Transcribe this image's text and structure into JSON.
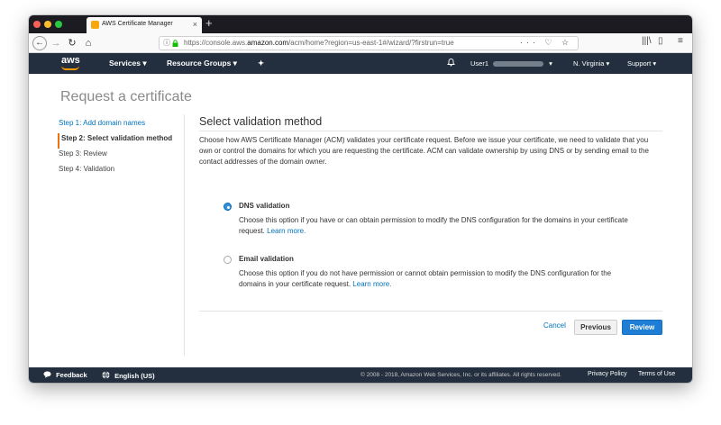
{
  "browser": {
    "tab_title": "AWS Certificate Manager",
    "tab_close": "×",
    "new_tab": "+",
    "url_prefix": "https://console.aws.",
    "url_domain": "amazon.com",
    "url_path": "/acm/home?region=us-east-1#/wizard/?firstrun=true",
    "nav": {
      "back": "←",
      "forward": "→",
      "reload": "↻",
      "home": "⌂",
      "info": "ⓘ",
      "actions": "··· ♡ ☆",
      "library": "|||\\",
      "sidebar": "▯",
      "menu": "≡"
    }
  },
  "aws_header": {
    "logo": "aws",
    "services": "Services ▾",
    "resource_groups": "Resource Groups ▾",
    "pin": "✦",
    "bell": "🔔",
    "user": "User1",
    "user_caret": "▾",
    "region": "N. Virginia ▾",
    "support": "Support ▾"
  },
  "page": {
    "title": "Request a certificate",
    "steps": [
      {
        "label": "Step 1: Add domain names",
        "state": "link"
      },
      {
        "label": "Step 2: Select validation method",
        "state": "active"
      },
      {
        "label": "Step 3: Review",
        "state": "normal"
      },
      {
        "label": "Step 4: Validation",
        "state": "normal"
      }
    ],
    "section_title": "Select validation method",
    "description": "Choose how AWS Certificate Manager (ACM) validates your certificate request. Before we issue your certificate, we need to validate that you own or control the domains for which you are requesting the certificate. ACM can validate ownership by using DNS or by sending email to the contact addresses of the domain owner.",
    "options": [
      {
        "title": "DNS validation",
        "selected": true,
        "desc": "Choose this option if you have or can obtain permission to modify the DNS configuration for the domains in your certificate request.",
        "link": "Learn more."
      },
      {
        "title": "Email validation",
        "selected": false,
        "desc": "Choose this option if you do not have permission or cannot obtain permission to modify the DNS configuration for the domains in your certificate request.",
        "link": "Learn more."
      }
    ],
    "buttons": {
      "cancel": "Cancel",
      "previous": "Previous",
      "review": "Review"
    }
  },
  "footer": {
    "feedback": "Feedback",
    "language": "English (US)",
    "copyright": "© 2008 - 2018, Amazon Web Services, Inc. or its affiliates. All rights reserved.",
    "privacy": "Privacy Policy",
    "terms": "Terms of Use"
  },
  "colors": {
    "aws_nav": "#232f3e",
    "aws_orange": "#ff9900",
    "link_blue": "#0073bb",
    "primary_button": "#1e7dd4"
  }
}
